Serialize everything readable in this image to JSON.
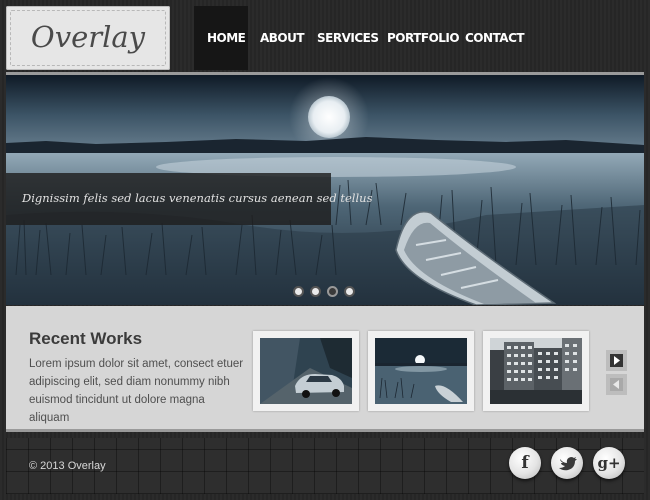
{
  "logo": {
    "text": "Overlay"
  },
  "nav": {
    "items": [
      "HOME",
      "ABOUT",
      "SERVICES",
      "PORTFOLIO",
      "CONTACT"
    ],
    "active": "HOME"
  },
  "hero": {
    "caption": "Dignissim felis sed lacus venenatis cursus aenean sed tellus",
    "slide_count": 4,
    "active_slide": 3
  },
  "works": {
    "title": "Recent Works",
    "text": "Lorem ipsum dolor sit amet, consect etuer adipiscing elit, sed diam nonummy nibh euismod tincidunt ut dolore magna aliquam",
    "thumbnails": [
      "car-on-road-image",
      "lake-moonlight-image",
      "city-buildings-image"
    ]
  },
  "footer": {
    "copyright": "© 2013 Overlay",
    "social": {
      "facebook": "f",
      "twitter": "twitter-bird-icon",
      "google_plus": "g+"
    }
  },
  "colors": {
    "dark": "#1e1e1e",
    "panel": "#d6d6d6",
    "accent": "#16202c"
  }
}
